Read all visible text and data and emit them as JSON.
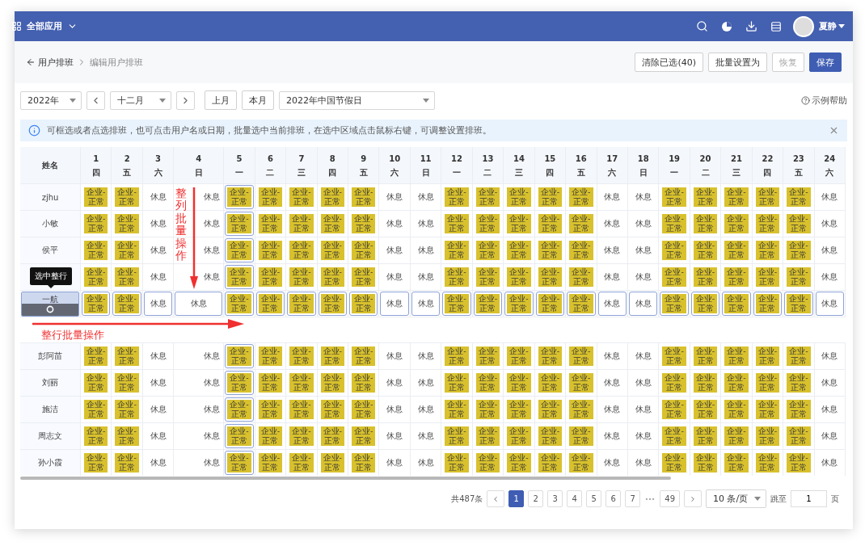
{
  "topbar": {
    "app_menu": "全部应用",
    "user": "夏静"
  },
  "breadcrumb": {
    "back": "用户排班",
    "current": "编辑用户排班"
  },
  "actions": [
    {
      "label": "清除已选(40)",
      "kind": "default"
    },
    {
      "label": "批量设置为",
      "kind": "default"
    },
    {
      "label": "恢复",
      "kind": "disabled"
    },
    {
      "label": "保存",
      "kind": "primary"
    }
  ],
  "filters": {
    "year": "2022年",
    "month": "十二月",
    "prev_month": "上月",
    "this_month": "本月",
    "holiday": "2022年中国节假日",
    "help": "示例帮助"
  },
  "notice": "可框选或者点选排班，也可点击用户名或日期，批量选中当前排班，在选中区域点击鼠标右键，可调整设置排班。",
  "table": {
    "name_header": "姓名",
    "columns": [
      {
        "day": "1",
        "weekday": "四"
      },
      {
        "day": "2",
        "weekday": "五"
      },
      {
        "day": "3",
        "weekday": "六"
      },
      {
        "day": "4",
        "weekday": "日"
      },
      {
        "day": "5",
        "weekday": "一"
      },
      {
        "day": "6",
        "weekday": "二"
      },
      {
        "day": "7",
        "weekday": "三"
      },
      {
        "day": "8",
        "weekday": "四"
      },
      {
        "day": "9",
        "weekday": "五"
      },
      {
        "day": "10",
        "weekday": "六"
      },
      {
        "day": "11",
        "weekday": "日"
      },
      {
        "day": "12",
        "weekday": "一"
      },
      {
        "day": "13",
        "weekday": "二"
      },
      {
        "day": "14",
        "weekday": "三"
      },
      {
        "day": "15",
        "weekday": "四"
      },
      {
        "day": "16",
        "weekday": "五"
      },
      {
        "day": "17",
        "weekday": "六"
      },
      {
        "day": "18",
        "weekday": "日"
      },
      {
        "day": "19",
        "weekday": "一"
      },
      {
        "day": "20",
        "weekday": "二"
      },
      {
        "day": "21",
        "weekday": "三"
      },
      {
        "day": "22",
        "weekday": "四"
      },
      {
        "day": "23",
        "weekday": "五"
      },
      {
        "day": "24",
        "weekday": "六"
      }
    ],
    "rows": [
      {
        "name": "zjhu",
        "selected": false,
        "cells": [
          {
            "kind": "work",
            "label": "企业-\n正常",
            "selected": false
          },
          {
            "kind": "work",
            "label": "企业-\n正常",
            "selected": false
          },
          {
            "kind": "rest",
            "label": "休息",
            "selected": false
          },
          {
            "kind": "rest",
            "label": "休息",
            "selected": false
          },
          {
            "kind": "work",
            "label": "企业-\n正常",
            "selected": true
          },
          {
            "kind": "work",
            "label": "企业-\n正常",
            "selected": false
          },
          {
            "kind": "work",
            "label": "企业-\n正常",
            "selected": false
          },
          {
            "kind": "work",
            "label": "企业-\n正常",
            "selected": false
          },
          {
            "kind": "work",
            "label": "企业-\n正常",
            "selected": false
          },
          {
            "kind": "rest",
            "label": "休息",
            "selected": false
          },
          {
            "kind": "rest",
            "label": "休息",
            "selected": false
          },
          {
            "kind": "work",
            "label": "企业-\n正常",
            "selected": false
          },
          {
            "kind": "work",
            "label": "企业-\n正常",
            "selected": false
          },
          {
            "kind": "work",
            "label": "企业-\n正常",
            "selected": false
          },
          {
            "kind": "work",
            "label": "企业-\n正常",
            "selected": false
          },
          {
            "kind": "work",
            "label": "企业-\n正常",
            "selected": false
          },
          {
            "kind": "rest",
            "label": "休息",
            "selected": false
          },
          {
            "kind": "rest",
            "label": "休息",
            "selected": false
          },
          {
            "kind": "work",
            "label": "企业-\n正常",
            "selected": false
          },
          {
            "kind": "work",
            "label": "企业-\n正常",
            "selected": false
          },
          {
            "kind": "work",
            "label": "企业-\n正常",
            "selected": false
          },
          {
            "kind": "work",
            "label": "企业-\n正常",
            "selected": false
          },
          {
            "kind": "work",
            "label": "企业-\n正常",
            "selected": false
          },
          {
            "kind": "rest",
            "label": "休息",
            "selected": false
          }
        ]
      },
      {
        "name": "小敏",
        "selected": false,
        "cells": [
          {
            "kind": "work",
            "label": "企业-\n正常",
            "selected": false
          },
          {
            "kind": "work",
            "label": "企业-\n正常",
            "selected": false
          },
          {
            "kind": "rest",
            "label": "休息",
            "selected": false
          },
          {
            "kind": "rest",
            "label": "休息",
            "selected": false
          },
          {
            "kind": "work",
            "label": "企业-\n正常",
            "selected": true
          },
          {
            "kind": "work",
            "label": "企业-\n正常",
            "selected": false
          },
          {
            "kind": "work",
            "label": "企业-\n正常",
            "selected": false
          },
          {
            "kind": "work",
            "label": "企业-\n正常",
            "selected": false
          },
          {
            "kind": "work",
            "label": "企业-\n正常",
            "selected": false
          },
          {
            "kind": "rest",
            "label": "休息",
            "selected": false
          },
          {
            "kind": "rest",
            "label": "休息",
            "selected": false
          },
          {
            "kind": "work",
            "label": "企业-\n正常",
            "selected": false
          },
          {
            "kind": "work",
            "label": "企业-\n正常",
            "selected": false
          },
          {
            "kind": "work",
            "label": "企业-\n正常",
            "selected": false
          },
          {
            "kind": "work",
            "label": "企业-\n正常",
            "selected": false
          },
          {
            "kind": "work",
            "label": "企业-\n正常",
            "selected": false
          },
          {
            "kind": "rest",
            "label": "休息",
            "selected": false
          },
          {
            "kind": "rest",
            "label": "休息",
            "selected": false
          },
          {
            "kind": "work",
            "label": "企业-\n正常",
            "selected": false
          },
          {
            "kind": "work",
            "label": "企业-\n正常",
            "selected": false
          },
          {
            "kind": "work",
            "label": "企业-\n正常",
            "selected": false
          },
          {
            "kind": "work",
            "label": "企业-\n正常",
            "selected": false
          },
          {
            "kind": "work",
            "label": "企业-\n正常",
            "selected": false
          },
          {
            "kind": "rest",
            "label": "休息",
            "selected": false
          }
        ]
      },
      {
        "name": "侯平",
        "selected": false,
        "cells": [
          {
            "kind": "work",
            "label": "企业-\n正常",
            "selected": false
          },
          {
            "kind": "work",
            "label": "企业-\n正常",
            "selected": false
          },
          {
            "kind": "rest",
            "label": "休息",
            "selected": false
          },
          {
            "kind": "rest",
            "label": "休息",
            "selected": false
          },
          {
            "kind": "work",
            "label": "企业-\n正常",
            "selected": true
          },
          {
            "kind": "work",
            "label": "企业-\n正常",
            "selected": false
          },
          {
            "kind": "work",
            "label": "企业-\n正常",
            "selected": false
          },
          {
            "kind": "work",
            "label": "企业-\n正常",
            "selected": false
          },
          {
            "kind": "work",
            "label": "企业-\n正常",
            "selected": false
          },
          {
            "kind": "rest",
            "label": "休息",
            "selected": false
          },
          {
            "kind": "rest",
            "label": "休息",
            "selected": false
          },
          {
            "kind": "work",
            "label": "企业-\n正常",
            "selected": false
          },
          {
            "kind": "work",
            "label": "企业-\n正常",
            "selected": false
          },
          {
            "kind": "work",
            "label": "企业-\n正常",
            "selected": false
          },
          {
            "kind": "work",
            "label": "企业-\n正常",
            "selected": false
          },
          {
            "kind": "work",
            "label": "企业-\n正常",
            "selected": false
          },
          {
            "kind": "rest",
            "label": "休息",
            "selected": false
          },
          {
            "kind": "rest",
            "label": "休息",
            "selected": false
          },
          {
            "kind": "work",
            "label": "企业-\n正常",
            "selected": false
          },
          {
            "kind": "work",
            "label": "企业-\n正常",
            "selected": false
          },
          {
            "kind": "work",
            "label": "企业-\n正常",
            "selected": false
          },
          {
            "kind": "work",
            "label": "企业-\n正常",
            "selected": false
          },
          {
            "kind": "work",
            "label": "企业-\n正常",
            "selected": false
          },
          {
            "kind": "rest",
            "label": "休息",
            "selected": false
          }
        ]
      },
      {
        "selected": false,
        "tooltip": "选中整行",
        "cells": [
          {
            "kind": "work",
            "label": "企业-\n正常",
            "selected": false
          },
          {
            "kind": "work",
            "label": "企业-\n正常",
            "selected": false
          },
          {
            "kind": "rest",
            "label": "休息",
            "selected": false
          },
          {
            "kind": "rest",
            "label": "休息",
            "selected": false
          },
          {
            "kind": "work",
            "label": "企业-\n正常",
            "selected": true
          },
          {
            "kind": "work",
            "label": "企业-\n正常",
            "selected": false
          },
          {
            "kind": "work",
            "label": "企业-\n正常",
            "selected": false
          },
          {
            "kind": "work",
            "label": "企业-\n正常",
            "selected": false
          },
          {
            "kind": "work",
            "label": "企业-\n正常",
            "selected": false
          },
          {
            "kind": "rest",
            "label": "休息",
            "selected": false
          },
          {
            "kind": "rest",
            "label": "休息",
            "selected": false
          },
          {
            "kind": "work",
            "label": "企业-\n正常",
            "selected": false
          },
          {
            "kind": "work",
            "label": "企业-\n正常",
            "selected": false
          },
          {
            "kind": "work",
            "label": "企业-\n正常",
            "selected": false
          },
          {
            "kind": "work",
            "label": "企业-\n正常",
            "selected": false
          },
          {
            "kind": "work",
            "label": "企业-\n正常",
            "selected": false
          },
          {
            "kind": "rest",
            "label": "休息",
            "selected": false
          },
          {
            "kind": "rest",
            "label": "休息",
            "selected": false
          },
          {
            "kind": "work",
            "label": "企业-\n正常",
            "selected": false
          },
          {
            "kind": "work",
            "label": "企业-\n正常",
            "selected": false
          },
          {
            "kind": "work",
            "label": "企业-\n正常",
            "selected": false
          },
          {
            "kind": "work",
            "label": "企业-\n正常",
            "selected": false
          },
          {
            "kind": "work",
            "label": "企业-\n正常",
            "selected": false
          },
          {
            "kind": "rest",
            "label": "休息",
            "selected": false
          }
        ]
      },
      {
        "name": "一航",
        "selected": true,
        "cells": [
          {
            "kind": "work",
            "label": "企业-\n正常",
            "selected": true
          },
          {
            "kind": "work",
            "label": "企业-\n正常",
            "selected": true
          },
          {
            "kind": "rest",
            "label": "休息",
            "selected": true
          },
          {
            "kind": "rest",
            "label": "休息",
            "selected": true
          },
          {
            "kind": "work",
            "label": "企业-\n正常",
            "selected": true
          },
          {
            "kind": "work",
            "label": "企业-\n正常",
            "selected": true
          },
          {
            "kind": "work",
            "label": "企业-\n正常",
            "selected": true
          },
          {
            "kind": "work",
            "label": "企业-\n正常",
            "selected": true
          },
          {
            "kind": "work",
            "label": "企业-\n正常",
            "selected": true
          },
          {
            "kind": "rest",
            "label": "休息",
            "selected": true
          },
          {
            "kind": "rest",
            "label": "休息",
            "selected": true
          },
          {
            "kind": "work",
            "label": "企业-\n正常",
            "selected": true
          },
          {
            "kind": "work",
            "label": "企业-\n正常",
            "selected": true
          },
          {
            "kind": "work",
            "label": "企业-\n正常",
            "selected": true
          },
          {
            "kind": "work",
            "label": "企业-\n正常",
            "selected": true
          },
          {
            "kind": "work",
            "label": "企业-\n正常",
            "selected": true
          },
          {
            "kind": "rest",
            "label": "休息",
            "selected": true
          },
          {
            "kind": "rest",
            "label": "休息",
            "selected": true
          },
          {
            "kind": "work",
            "label": "企业-\n正常",
            "selected": true
          },
          {
            "kind": "work",
            "label": "企业-\n正常",
            "selected": true
          },
          {
            "kind": "work",
            "label": "企业-\n正常",
            "selected": true
          },
          {
            "kind": "work",
            "label": "企业-\n正常",
            "selected": true
          },
          {
            "kind": "work",
            "label": "企业-\n正常",
            "selected": true
          },
          {
            "kind": "rest",
            "label": "休息",
            "selected": true
          }
        ]
      },
      {
        "name": "彭阿苗",
        "selected": false,
        "cells": [
          {
            "kind": "work",
            "label": "企业-\n正常",
            "selected": false
          },
          {
            "kind": "work",
            "label": "企业-\n正常",
            "selected": false
          },
          {
            "kind": "rest",
            "label": "休息",
            "selected": false
          },
          {
            "kind": "rest",
            "label": "休息",
            "selected": false
          },
          {
            "kind": "work",
            "label": "企业-\n正常",
            "selected": true
          },
          {
            "kind": "work",
            "label": "企业-\n正常",
            "selected": false
          },
          {
            "kind": "work",
            "label": "企业-\n正常",
            "selected": false
          },
          {
            "kind": "work",
            "label": "企业-\n正常",
            "selected": false
          },
          {
            "kind": "work",
            "label": "企业-\n正常",
            "selected": false
          },
          {
            "kind": "rest",
            "label": "休息",
            "selected": false
          },
          {
            "kind": "rest",
            "label": "休息",
            "selected": false
          },
          {
            "kind": "work",
            "label": "企业-\n正常",
            "selected": false
          },
          {
            "kind": "work",
            "label": "企业-\n正常",
            "selected": false
          },
          {
            "kind": "work",
            "label": "企业-\n正常",
            "selected": false
          },
          {
            "kind": "work",
            "label": "企业-\n正常",
            "selected": false
          },
          {
            "kind": "work",
            "label": "企业-\n正常",
            "selected": false
          },
          {
            "kind": "rest",
            "label": "休息",
            "selected": false
          },
          {
            "kind": "rest",
            "label": "休息",
            "selected": false
          },
          {
            "kind": "work",
            "label": "企业-\n正常",
            "selected": false
          },
          {
            "kind": "work",
            "label": "企业-\n正常",
            "selected": false
          },
          {
            "kind": "work",
            "label": "企业-\n正常",
            "selected": false
          },
          {
            "kind": "work",
            "label": "企业-\n正常",
            "selected": false
          },
          {
            "kind": "work",
            "label": "企业-\n正常",
            "selected": false
          },
          {
            "kind": "rest",
            "label": "休息",
            "selected": false
          }
        ]
      },
      {
        "name": "刘丽",
        "selected": false,
        "cells": [
          {
            "kind": "work",
            "label": "企业-\n正常",
            "selected": false
          },
          {
            "kind": "work",
            "label": "企业-\n正常",
            "selected": false
          },
          {
            "kind": "rest",
            "label": "休息",
            "selected": false
          },
          {
            "kind": "rest",
            "label": "休息",
            "selected": false
          },
          {
            "kind": "work",
            "label": "企业-\n正常",
            "selected": true
          },
          {
            "kind": "work",
            "label": "企业-\n正常",
            "selected": false
          },
          {
            "kind": "work",
            "label": "企业-\n正常",
            "selected": false
          },
          {
            "kind": "work",
            "label": "企业-\n正常",
            "selected": false
          },
          {
            "kind": "work",
            "label": "企业-\n正常",
            "selected": false
          },
          {
            "kind": "rest",
            "label": "休息",
            "selected": false
          },
          {
            "kind": "rest",
            "label": "休息",
            "selected": false
          },
          {
            "kind": "work",
            "label": "企业-\n正常",
            "selected": false
          },
          {
            "kind": "work",
            "label": "企业-\n正常",
            "selected": false
          },
          {
            "kind": "work",
            "label": "企业-\n正常",
            "selected": false
          },
          {
            "kind": "work",
            "label": "企业-\n正常",
            "selected": false
          },
          {
            "kind": "work",
            "label": "企业-\n正常",
            "selected": false
          },
          {
            "kind": "rest",
            "label": "休息",
            "selected": false
          },
          {
            "kind": "rest",
            "label": "休息",
            "selected": false
          },
          {
            "kind": "work",
            "label": "企业-\n正常",
            "selected": false
          },
          {
            "kind": "work",
            "label": "企业-\n正常",
            "selected": false
          },
          {
            "kind": "work",
            "label": "企业-\n正常",
            "selected": false
          },
          {
            "kind": "work",
            "label": "企业-\n正常",
            "selected": false
          },
          {
            "kind": "work",
            "label": "企业-\n正常",
            "selected": false
          },
          {
            "kind": "rest",
            "label": "休息",
            "selected": false
          }
        ]
      },
      {
        "name": "施洁",
        "selected": false,
        "cells": [
          {
            "kind": "work",
            "label": "企业-\n正常",
            "selected": false
          },
          {
            "kind": "work",
            "label": "企业-\n正常",
            "selected": false
          },
          {
            "kind": "rest",
            "label": "休息",
            "selected": false
          },
          {
            "kind": "rest",
            "label": "休息",
            "selected": false
          },
          {
            "kind": "work",
            "label": "企业-\n正常",
            "selected": true
          },
          {
            "kind": "work",
            "label": "企业-\n正常",
            "selected": false
          },
          {
            "kind": "work",
            "label": "企业-\n正常",
            "selected": false
          },
          {
            "kind": "work",
            "label": "企业-\n正常",
            "selected": false
          },
          {
            "kind": "work",
            "label": "企业-\n正常",
            "selected": false
          },
          {
            "kind": "rest",
            "label": "休息",
            "selected": false
          },
          {
            "kind": "rest",
            "label": "休息",
            "selected": false
          },
          {
            "kind": "work",
            "label": "企业-\n正常",
            "selected": false
          },
          {
            "kind": "work",
            "label": "企业-\n正常",
            "selected": false
          },
          {
            "kind": "work",
            "label": "企业-\n正常",
            "selected": false
          },
          {
            "kind": "work",
            "label": "企业-\n正常",
            "selected": false
          },
          {
            "kind": "work",
            "label": "企业-\n正常",
            "selected": false
          },
          {
            "kind": "rest",
            "label": "休息",
            "selected": false
          },
          {
            "kind": "rest",
            "label": "休息",
            "selected": false
          },
          {
            "kind": "work",
            "label": "企业-\n正常",
            "selected": false
          },
          {
            "kind": "work",
            "label": "企业-\n正常",
            "selected": false
          },
          {
            "kind": "work",
            "label": "企业-\n正常",
            "selected": false
          },
          {
            "kind": "work",
            "label": "企业-\n正常",
            "selected": false
          },
          {
            "kind": "work",
            "label": "企业-\n正常",
            "selected": false
          },
          {
            "kind": "rest",
            "label": "休息",
            "selected": false
          }
        ]
      },
      {
        "name": "周志文",
        "selected": false,
        "cells": [
          {
            "kind": "work",
            "label": "企业-\n正常",
            "selected": false
          },
          {
            "kind": "work",
            "label": "企业-\n正常",
            "selected": false
          },
          {
            "kind": "rest",
            "label": "休息",
            "selected": false
          },
          {
            "kind": "rest",
            "label": "休息",
            "selected": false
          },
          {
            "kind": "work",
            "label": "企业-\n正常",
            "selected": true
          },
          {
            "kind": "work",
            "label": "企业-\n正常",
            "selected": false
          },
          {
            "kind": "work",
            "label": "企业-\n正常",
            "selected": false
          },
          {
            "kind": "work",
            "label": "企业-\n正常",
            "selected": false
          },
          {
            "kind": "work",
            "label": "企业-\n正常",
            "selected": false
          },
          {
            "kind": "rest",
            "label": "休息",
            "selected": false
          },
          {
            "kind": "rest",
            "label": "休息",
            "selected": false
          },
          {
            "kind": "work",
            "label": "企业-\n正常",
            "selected": false
          },
          {
            "kind": "work",
            "label": "企业-\n正常",
            "selected": false
          },
          {
            "kind": "work",
            "label": "企业-\n正常",
            "selected": false
          },
          {
            "kind": "work",
            "label": "企业-\n正常",
            "selected": false
          },
          {
            "kind": "work",
            "label": "企业-\n正常",
            "selected": false
          },
          {
            "kind": "rest",
            "label": "休息",
            "selected": false
          },
          {
            "kind": "rest",
            "label": "休息",
            "selected": false
          },
          {
            "kind": "work",
            "label": "企业-\n正常",
            "selected": false
          },
          {
            "kind": "work",
            "label": "企业-\n正常",
            "selected": false
          },
          {
            "kind": "work",
            "label": "企业-\n正常",
            "selected": false
          },
          {
            "kind": "work",
            "label": "企业-\n正常",
            "selected": false
          },
          {
            "kind": "work",
            "label": "企业-\n正常",
            "selected": false
          },
          {
            "kind": "rest",
            "label": "休息",
            "selected": false
          }
        ]
      },
      {
        "name": "孙小霞",
        "selected": false,
        "cells": [
          {
            "kind": "work",
            "label": "企业-\n正常",
            "selected": false
          },
          {
            "kind": "work",
            "label": "企业-\n正常",
            "selected": false
          },
          {
            "kind": "rest",
            "label": "休息",
            "selected": false
          },
          {
            "kind": "rest",
            "label": "休息",
            "selected": false
          },
          {
            "kind": "work",
            "label": "企业-\n正常",
            "selected": true
          },
          {
            "kind": "work",
            "label": "企业-\n正常",
            "selected": false
          },
          {
            "kind": "work",
            "label": "企业-\n正常",
            "selected": false
          },
          {
            "kind": "work",
            "label": "企业-\n正常",
            "selected": false
          },
          {
            "kind": "work",
            "label": "企业-\n正常",
            "selected": false
          },
          {
            "kind": "rest",
            "label": "休息",
            "selected": false
          },
          {
            "kind": "rest",
            "label": "休息",
            "selected": false
          },
          {
            "kind": "work",
            "label": "企业-\n正常",
            "selected": false
          },
          {
            "kind": "work",
            "label": "企业-\n正常",
            "selected": false
          },
          {
            "kind": "work",
            "label": "企业-\n正常",
            "selected": false
          },
          {
            "kind": "work",
            "label": "企业-\n正常",
            "selected": false
          },
          {
            "kind": "work",
            "label": "企业-\n正常",
            "selected": false
          },
          {
            "kind": "rest",
            "label": "休息",
            "selected": false
          },
          {
            "kind": "rest",
            "label": "休息",
            "selected": false
          },
          {
            "kind": "work",
            "label": "企业-\n正常",
            "selected": false
          },
          {
            "kind": "work",
            "label": "企业-\n正常",
            "selected": false
          },
          {
            "kind": "work",
            "label": "企业-\n正常",
            "selected": false
          },
          {
            "kind": "work",
            "label": "企业-\n正常",
            "selected": false
          },
          {
            "kind": "work",
            "label": "企业-\n正常",
            "selected": false
          },
          {
            "kind": "rest",
            "label": "休息",
            "selected": false
          }
        ]
      }
    ]
  },
  "annotations": [
    {
      "kind": "column",
      "text": "整列批量操作"
    },
    {
      "kind": "row",
      "text": "整行批量操作"
    }
  ],
  "pagination": {
    "total": "共487条",
    "pages": [
      {
        "label": "1",
        "selected": true
      },
      {
        "label": "2",
        "selected": false
      },
      {
        "label": "3",
        "selected": false
      },
      {
        "label": "4",
        "selected": false
      },
      {
        "label": "5",
        "selected": false
      },
      {
        "label": "6",
        "selected": false
      },
      {
        "label": "7",
        "selected": false
      }
    ],
    "last": "49",
    "page_size": "10 条/页",
    "jump_label": "跳至",
    "jump_value": "1",
    "jump_suffix": "页"
  }
}
